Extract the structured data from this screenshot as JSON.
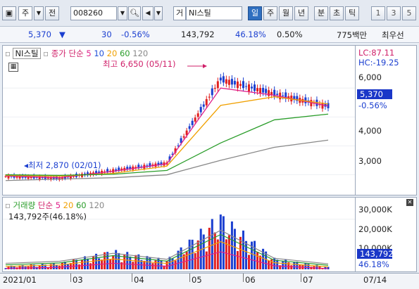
{
  "toolbar": {
    "market_select": "주",
    "prev_label": "전",
    "stock_code": "008260",
    "stock_name": "NI스틸",
    "mode_prefix": "거",
    "period_tabs": [
      "일",
      "주",
      "월",
      "년",
      "분",
      "초",
      "틱"
    ],
    "active_period": "일",
    "interval_buttons": [
      "1",
      "3",
      "5"
    ]
  },
  "quote": {
    "price": "5,370",
    "direction_symbol": "▼",
    "change": "30",
    "change_pct": "-0.56%",
    "volume": "143,792",
    "ratio1": "46.18%",
    "ratio2": "0.50%",
    "market_cap": "775백만",
    "extra": "최우선"
  },
  "price_panel": {
    "title_tag": "NI스틸",
    "legend_prefix": "종가",
    "legend_ma_label": "단순",
    "ma_periods": [
      "5",
      "10",
      "20",
      "60",
      "120"
    ],
    "ma_colors": [
      "#e0208a",
      "#2050d8",
      "#f0a000",
      "#2a9d2a",
      "#888888"
    ],
    "high_note": "최고 6,650 (05/11)",
    "low_note": "최저 2,870 (02/01)",
    "lc_label": "LC:87.11",
    "hc_label": "HC:-19.25",
    "scale_ticks": [
      "6,000",
      "5,000",
      "4,000",
      "3,000"
    ],
    "price_tag": "5,370",
    "price_tag_pct": "-0.56%"
  },
  "volume_panel": {
    "title": "거래량",
    "legend_ma_label": "단순",
    "ma_periods": [
      "5",
      "20",
      "60",
      "120"
    ],
    "ma_colors": [
      "#e0208a",
      "#f0a000",
      "#2a9d2a",
      "#888888"
    ],
    "volume_text": "143,792주(46.18%)",
    "scale_ticks": [
      "30,000K",
      "20,000K",
      "10,000K"
    ],
    "vol_tag": "143,792",
    "vol_tag_pct": "46.18%"
  },
  "x_axis": {
    "labels": [
      "2021/01",
      "03",
      "04",
      "05",
      "06",
      "07"
    ],
    "last_date": "07/14"
  },
  "chart_data": {
    "type": "line",
    "title": "NI스틸",
    "x": [
      "2021/01",
      "2021/02",
      "2021/03",
      "2021/04",
      "2021/05",
      "2021/06",
      "2021/07"
    ],
    "series": [
      {
        "name": "종가",
        "values": [
          2950,
          2880,
          3150,
          3400,
          6300,
          5800,
          5370
        ]
      },
      {
        "name": "5",
        "values": [
          2960,
          2900,
          3120,
          3380,
          6000,
          5750,
          5380
        ]
      },
      {
        "name": "20",
        "values": [
          2980,
          2950,
          3050,
          3300,
          5400,
          5700,
          5450
        ]
      },
      {
        "name": "60",
        "values": [
          3000,
          2980,
          3020,
          3150,
          4100,
          4900,
          5100
        ]
      },
      {
        "name": "120",
        "values": [
          2800,
          2850,
          2900,
          3000,
          3500,
          3950,
          4200
        ]
      }
    ],
    "ylim": [
      2600,
      7100
    ],
    "volume_series": {
      "name": "거래량",
      "x": [
        "2021/01",
        "2021/02",
        "2021/03",
        "2021/04",
        "2021/05",
        "2021/06",
        "2021/07"
      ],
      "values": [
        2000,
        4000,
        12000,
        6000,
        35000,
        7000,
        1500
      ]
    }
  }
}
